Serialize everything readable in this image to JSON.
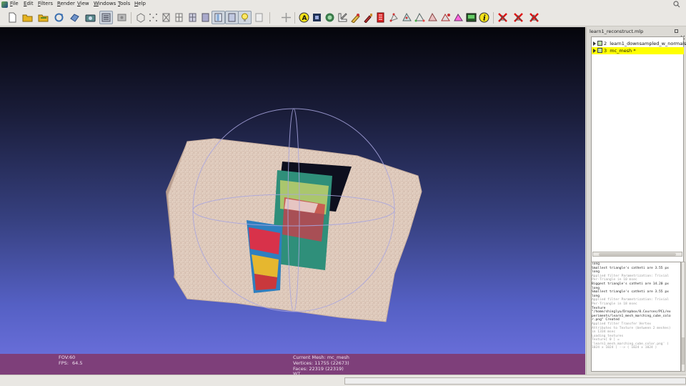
{
  "menubar": {
    "items": [
      {
        "label": "File"
      },
      {
        "label": "Edit"
      },
      {
        "label": "Filters"
      },
      {
        "label": "Render"
      },
      {
        "label": "View"
      },
      {
        "label": "Windows"
      },
      {
        "label": "Tools"
      },
      {
        "label": "Help"
      }
    ]
  },
  "toolbar": {
    "icons": [
      "new-project-icon",
      "open-project-icon",
      "open-file-icon",
      "reload-icon",
      "save-snapshot-icon",
      "camera-icon",
      "bounding-box-mode-icon",
      "points-mode-icon",
      "wireframe-icon",
      "hidden-lines-icon",
      "flat-lines-icon",
      "flat-shading-icon",
      "smooth-shading-icon",
      "texture-icon",
      "light-icon",
      "selection-icon",
      "annotation-a-icon",
      "info-panel-icon",
      "align-icon",
      "measure-icon",
      "pick-icon",
      "paint-icon",
      "raster-icon",
      "edit-points-icon",
      "select-faces-icon",
      "select-vertices-icon",
      "select-connected-icon",
      "texture-paint-icon",
      "z-paint-icon",
      "color-frame-icon",
      "info-icon",
      "delete-faces-icon",
      "delete-vertices-icon",
      "delete-all-icon"
    ]
  },
  "viewport": {
    "fov_label": "FOV:",
    "fov_value": "60",
    "fps_label": "FPS:",
    "fps_value": "64.5",
    "current_mesh": "Current Mesh: mc_mesh",
    "vertices": "Vertices: 11755 (22673)",
    "faces": "Faces: 22319 (22319)",
    "extra": "WT"
  },
  "project": {
    "title": "learn1_reconstruct.mlp",
    "layers": [
      {
        "index": "2",
        "name": "learn1_downsampled_w_normals.ply",
        "selected": false
      },
      {
        "index": "3",
        "name": "mc_mesh *",
        "selected": true
      }
    ]
  },
  "log": {
    "lines": [
      {
        "text": "long",
        "dim": false
      },
      {
        "text": "Smallest triangle's catheti are 3.55 px",
        "dim": false
      },
      {
        "text": "long",
        "dim": false
      },
      {
        "text": "Applied filter Parametrization: Trivial",
        "dim": true
      },
      {
        "text": "Per-Triangle in 10 msec",
        "dim": true
      },
      {
        "text": "Biggest triangle's catheti are 14.20 px",
        "dim": false
      },
      {
        "text": "long",
        "dim": false
      },
      {
        "text": "Smallest triangle's catheti are 3.55 px",
        "dim": false
      },
      {
        "text": "long",
        "dim": false
      },
      {
        "text": "Applied filter Parametrization: Trivial",
        "dim": true
      },
      {
        "text": "Per-Triangle in 18 msec",
        "dim": true
      },
      {
        "text": "Texture",
        "dim": false
      },
      {
        "text": "\"/home/shinglyu/Dropbox/0.Courses/PCL/ex",
        "dim": false
      },
      {
        "text": "periments/learn1_mesh_marching_cube_colo",
        "dim": false
      },
      {
        "text": "r.png\" Created",
        "dim": false
      },
      {
        "text": "Applied filter Transfer Vertex",
        "dim": true
      },
      {
        "text": "Attributes to Texture (between 2 meshes)",
        "dim": true
      },
      {
        "text": "in 1334 msec",
        "dim": true
      },
      {
        "text": "Loading textures",
        "dim": true
      },
      {
        "text": "Texture[ 0 ] =",
        "dim": true
      },
      {
        "text": "'learn1_mesh_marching_cube_color.png' (",
        "dim": true
      },
      {
        "text": "1024 x 1024 ) --> ( 1024 x 1024 )",
        "dim": true
      }
    ]
  },
  "colors": {
    "infobar": "#7e3f7a",
    "selection": "#ffff00",
    "background_top": "#05050b",
    "background_bottom": "#6f73e0"
  }
}
